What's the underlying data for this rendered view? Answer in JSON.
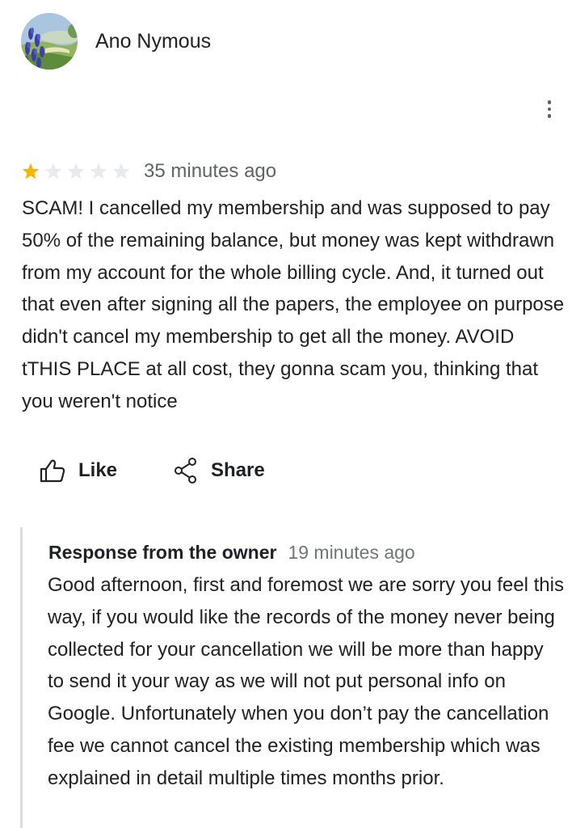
{
  "review": {
    "author_name": "Ano Nymous",
    "avatar_icon": "landscape-avatar-icon",
    "menu_icon": "more-vert-icon",
    "rating": 1,
    "rating_max": 5,
    "star_filled_color": "#f6b704",
    "star_empty_color": "#e8eaed",
    "time": "35 minutes ago",
    "text": "SCAM! I cancelled my membership and was supposed to pay 50% of the remaining balance, but money was kept withdrawn from my account for the whole billing cycle. And, it turned out that even after signing all the papers, the employee on purpose didn't cancel my membership to get all the money. AVOID tTHIS PLACE at all cost, they gonna scam you, thinking that you weren't notice"
  },
  "actions": {
    "like_label": "Like",
    "like_icon": "thumbs-up-icon",
    "share_label": "Share",
    "share_icon": "share-icon"
  },
  "owner_response": {
    "title": "Response from the owner",
    "time": "19 minutes ago",
    "text": "Good afternoon, first and foremost we are sorry you feel this way, if you would like the records of the money never being collected for your cancellation we will be more than happy to send it your way as we will not put personal info on Google. Unfortunately when you don’t pay the cancellation fee we cannot cancel the existing membership which was explained in detail multiple times months prior."
  }
}
